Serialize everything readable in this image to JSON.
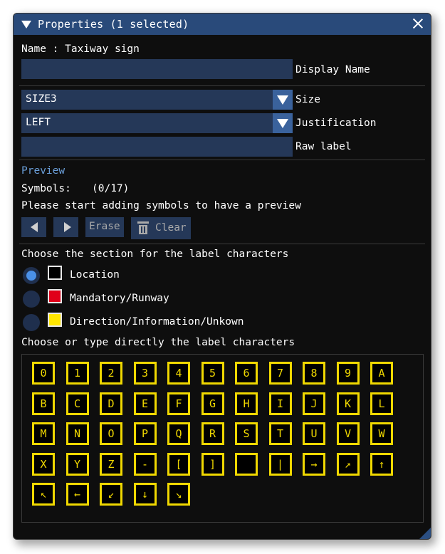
{
  "window": {
    "title": "Properties (1 selected)"
  },
  "name_line": "Name : Taxiway sign",
  "fields": {
    "display_name": {
      "value": "",
      "label": "Display Name"
    },
    "size": {
      "value": "SIZE3",
      "label": "Size"
    },
    "justification": {
      "value": "LEFT",
      "label": "Justification"
    },
    "raw_label": {
      "value": "",
      "label": "Raw label"
    }
  },
  "preview": {
    "header": "Preview",
    "symbols_label": "Symbols:",
    "symbols_count": "(0/17)",
    "hint": "Please start adding symbols to have a preview",
    "erase_label": "Erase",
    "clear_label": "Clear"
  },
  "section_prompt": "Choose the section for the label characters",
  "sections": [
    {
      "label": "Location",
      "color": "#000000",
      "selected": true
    },
    {
      "label": "Mandatory/Runway",
      "color": "#e0001a",
      "selected": false
    },
    {
      "label": "Direction/Information/Unkown",
      "color": "#ffe600",
      "selected": false
    }
  ],
  "chars_prompt": "Choose or type directly the label characters",
  "characters": [
    "0",
    "1",
    "2",
    "3",
    "4",
    "5",
    "6",
    "7",
    "8",
    "9",
    "A",
    "B",
    "C",
    "D",
    "E",
    "F",
    "G",
    "H",
    "I",
    "J",
    "K",
    "L",
    "M",
    "N",
    "O",
    "P",
    "Q",
    "R",
    "S",
    "T",
    "U",
    "V",
    "W",
    "X",
    "Y",
    "Z",
    "-",
    "[",
    "]",
    "",
    "|",
    "→",
    "↗",
    "↑",
    "↖",
    "←",
    "↙",
    "↓",
    "↘"
  ],
  "colors": {
    "accent": "#294a7a",
    "field_bg": "#253858",
    "key_yellow": "#f0d800"
  }
}
